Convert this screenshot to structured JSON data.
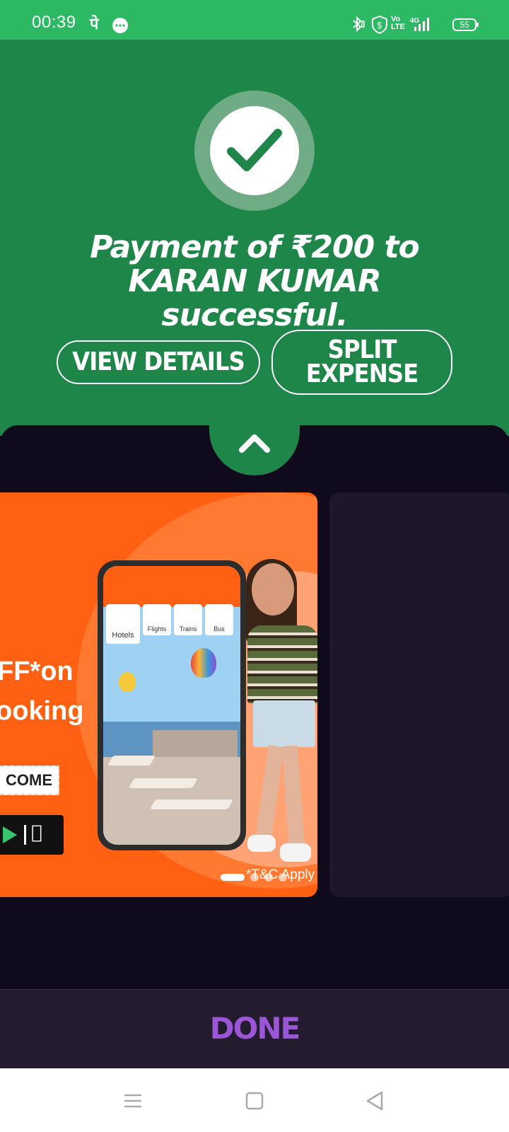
{
  "status_bar": {
    "time": "00:39",
    "left_icons": [
      "phonepe-icon",
      "message-icon"
    ],
    "right_icons": [
      "bluetooth-icon",
      "shield-icon",
      "volte-icon",
      "signal-4g-icon"
    ],
    "battery": "55"
  },
  "success": {
    "message": "Payment of ₹200 to KARAN KUMAR successful.",
    "view_details_label": "VIEW DETAILS",
    "split_expense_label": "SPLIT EXPENSE",
    "colors": {
      "panel": "#1f864a",
      "check": "#1f864a"
    }
  },
  "banner": {
    "line1": "FF*on",
    "line2": "ooking",
    "coupon": "COME",
    "phone_tiles": [
      "Hotels",
      "Flights",
      "Trains",
      "Bus"
    ],
    "tnc": "*T&C Apply",
    "slides": 4,
    "active_slide": 0
  },
  "footer": {
    "done_label": "DONE",
    "accent": "#9b56d8"
  },
  "nav_bar": {
    "buttons": [
      "menu-icon",
      "home-icon",
      "back-icon"
    ]
  }
}
